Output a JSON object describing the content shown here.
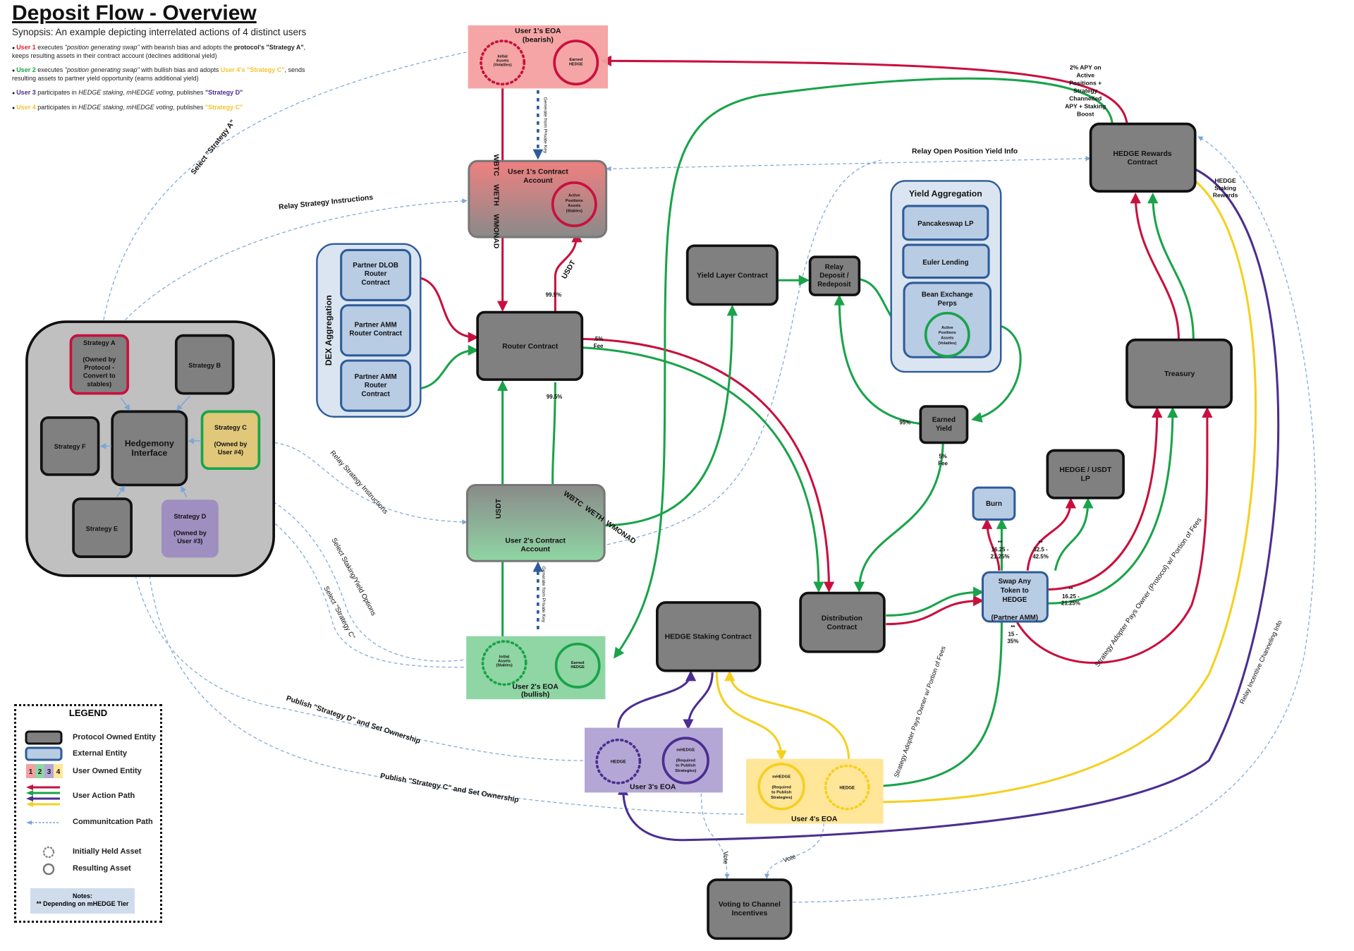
{
  "header": {
    "title": "Deposit Flow - Overview",
    "synopsis": "Synopsis: An example depicting interrelated actions of 4 distinct users",
    "bullets": [
      {
        "user": "User 1",
        "parts": [
          " executes ",
          "\"position generating swap\"",
          " with bearish bias and adopts the ",
          "protocol's \"Strategy A\"",
          ", keeps resulting assets in their contract account (declines additional yield)"
        ]
      },
      {
        "user": "User 2",
        "parts": [
          " executes ",
          "\"position generating swap\"",
          " with bullish bias and adopts ",
          "User 4's \"Strategy C\"",
          ", sends resulting assets to partner yield opportunity (earns additional yield)"
        ]
      },
      {
        "user": "User 3",
        "parts": [
          " participates in ",
          "HEDGE staking",
          ", ",
          "mHEDGE voting",
          ", publishes ",
          "\"Strategy D\""
        ]
      },
      {
        "user": "User 4",
        "parts": [
          " participates in ",
          "HEDGE staking",
          ", ",
          "mHEDGE voting",
          ", publishes ",
          "\"Strategy C\""
        ]
      }
    ]
  },
  "colors": {
    "user1": "#c8103e",
    "user2": "#1aa34a",
    "user3": "#4b2e91",
    "user4": "#f5d020",
    "comm": "#7ea6d6",
    "protocol_fill": "#808080",
    "external_fill": "#b8cce4",
    "external_stroke": "#2e5c99"
  },
  "nodes": {
    "user1_eoa": {
      "title": "User 1's EOA",
      "subtitle": "(bearish)",
      "initial": [
        "Initial",
        "Assets",
        "(Volatiles)"
      ],
      "earned": [
        "Earned",
        "HEDGE"
      ]
    },
    "user1_contract": {
      "title": [
        "User 1's Contract",
        "Account"
      ],
      "asset": [
        "Active",
        "Positions",
        "Assets",
        "(Stables)"
      ]
    },
    "user2_contract": {
      "title": [
        "User 2's Contract",
        "Account"
      ]
    },
    "user2_eoa": {
      "title": "User 2's EOA",
      "subtitle": "(bullish)",
      "initial": [
        "Initial",
        "Assets",
        "(Stables)"
      ],
      "earned": [
        "Earned",
        "HEDGE"
      ]
    },
    "user3_eoa": {
      "title": "User 3's EOA",
      "hedge": "HEDGE",
      "mhedge": [
        "mHEDGE",
        "",
        "(Required",
        "to Publish",
        "Strategies)"
      ]
    },
    "user4_eoa": {
      "title": "User 4's EOA",
      "hedge": "HEDGE",
      "mhedge": [
        "mHEDGE",
        "",
        "(Required",
        "to Publish",
        "Strategies)"
      ]
    },
    "router": [
      "Router Contract"
    ],
    "dex_group": "DEX Aggregation",
    "dex_items": [
      [
        "Partner DLOB",
        "Router",
        "Contract"
      ],
      [
        "Partner AMM",
        "Router Contract"
      ],
      [
        "Partner AMM",
        "Router",
        "Contract"
      ]
    ],
    "yield_layer": [
      "Yield Layer Contract"
    ],
    "relay_deposit": [
      "Relay",
      "Deposit /",
      "Redeposit"
    ],
    "yield_group": "Yield Aggregation",
    "yield_items": [
      [
        "Pancakeswap LP"
      ],
      [
        "Euler Lending"
      ],
      [
        "Bean Exchange",
        "Perps"
      ]
    ],
    "yield_asset": [
      "Active",
      "Positions",
      "Assets",
      "(Volatiles)"
    ],
    "earned_yield": [
      "Earned",
      "Yield"
    ],
    "hedge_rewards": [
      "HEDGE Rewards",
      "Contract"
    ],
    "treasury": [
      "Treasury"
    ],
    "hedge_usdt_lp": [
      "HEDGE / USDT",
      "LP"
    ],
    "burn": [
      "Burn"
    ],
    "swap": [
      "Swap Any",
      "Token to",
      "HEDGE",
      "",
      "(Partner AMM)"
    ],
    "distribution": [
      "Distribution",
      "Contract"
    ],
    "staking": [
      "HEDGE Staking Contract"
    ],
    "voting": [
      "Voting to Channel",
      "Incentives"
    ],
    "strategies": {
      "a": [
        "Strategy A",
        "",
        "(Owned by",
        "Protocol -",
        "Convert to",
        "stables)"
      ],
      "b": [
        "Strategy B"
      ],
      "c": [
        "Strategy C",
        "",
        "(Owned by",
        "User #4)"
      ],
      "d": [
        "Strategy D",
        "",
        "(Owned by",
        "User #3)"
      ],
      "e": [
        "Strategy E"
      ],
      "f": [
        "Strategy F"
      ],
      "interface": [
        "Hedgemony",
        "Interface"
      ]
    }
  },
  "labels": {
    "gen_key_1": "Generate from Private Key",
    "gen_key_2": "Generate from Private Key",
    "tokens_u1": "WBTC    WETH    WMONAD",
    "usdt_u1": "USDT",
    "pct_router_top": "99.5%",
    "pct_router_bottom": "99.5%",
    "fee_router": [
      ".5%",
      "Fee"
    ],
    "usdt_u2": "USDT",
    "tokens_u2": "WBTC  WETH  WMONAD",
    "pct_95": "95%",
    "fee_yield": [
      "5%",
      "Fee"
    ],
    "burn_pct": [
      "**",
      "16.25 -",
      "21.25%"
    ],
    "lp_pct": [
      "**",
      "32.5 -",
      "42.5%"
    ],
    "treasury_pct": [
      "**",
      "16.25 -",
      "21.25%"
    ],
    "swap_bottom_pct": [
      "**",
      "15 -",
      "35%"
    ],
    "apy_note": [
      "2% APY on",
      "Active",
      "Positions +",
      "Strategy",
      "Channelled",
      "APY + Staking",
      "Boost"
    ],
    "staking_rewards": [
      "HEDGE",
      "Staking",
      "Rewards"
    ],
    "select_strategy_a": "Select \"Strategy A\"",
    "relay_strategy_1": "Relay Strategy Instructions",
    "relay_open_position": "Relay Open Position Yield Info",
    "relay_strategy_2": "Relay Strategy Instructions",
    "select_staking": "Select Staking/Yield Options",
    "select_strategy_c": "Select \"Strategy C\"",
    "publish_d": "Publish \"Strategy D\" and Set Ownership",
    "publish_c": "Publish \"Strategy C\" and Set Ownership",
    "adopter_pays_1": "Strategy Adopter Pays Owner w/ Portion of Fees",
    "adopter_pays_2": "Strategy Adopter Pays Owner (Protocol) w/ Portion of Fees",
    "relay_incentive": "Relay Incentive Channeling Info",
    "vote_1": "Vote",
    "vote_2": "Vote"
  },
  "legend": {
    "title": "LEGEND",
    "protocol": "Protocol Owned Entity",
    "external": "External Entity",
    "user_owned": "User Owned Entity",
    "user_numbers": [
      "1",
      "2",
      "3",
      "4"
    ],
    "action_path": "User Action Path",
    "comm_path": "Communitcation Path",
    "initial_asset": "Initially Held Asset",
    "resulting_asset": "Resulting  Asset",
    "notes_title": "Notes:",
    "notes_text": "** Depending on mHEDGE Tier"
  }
}
